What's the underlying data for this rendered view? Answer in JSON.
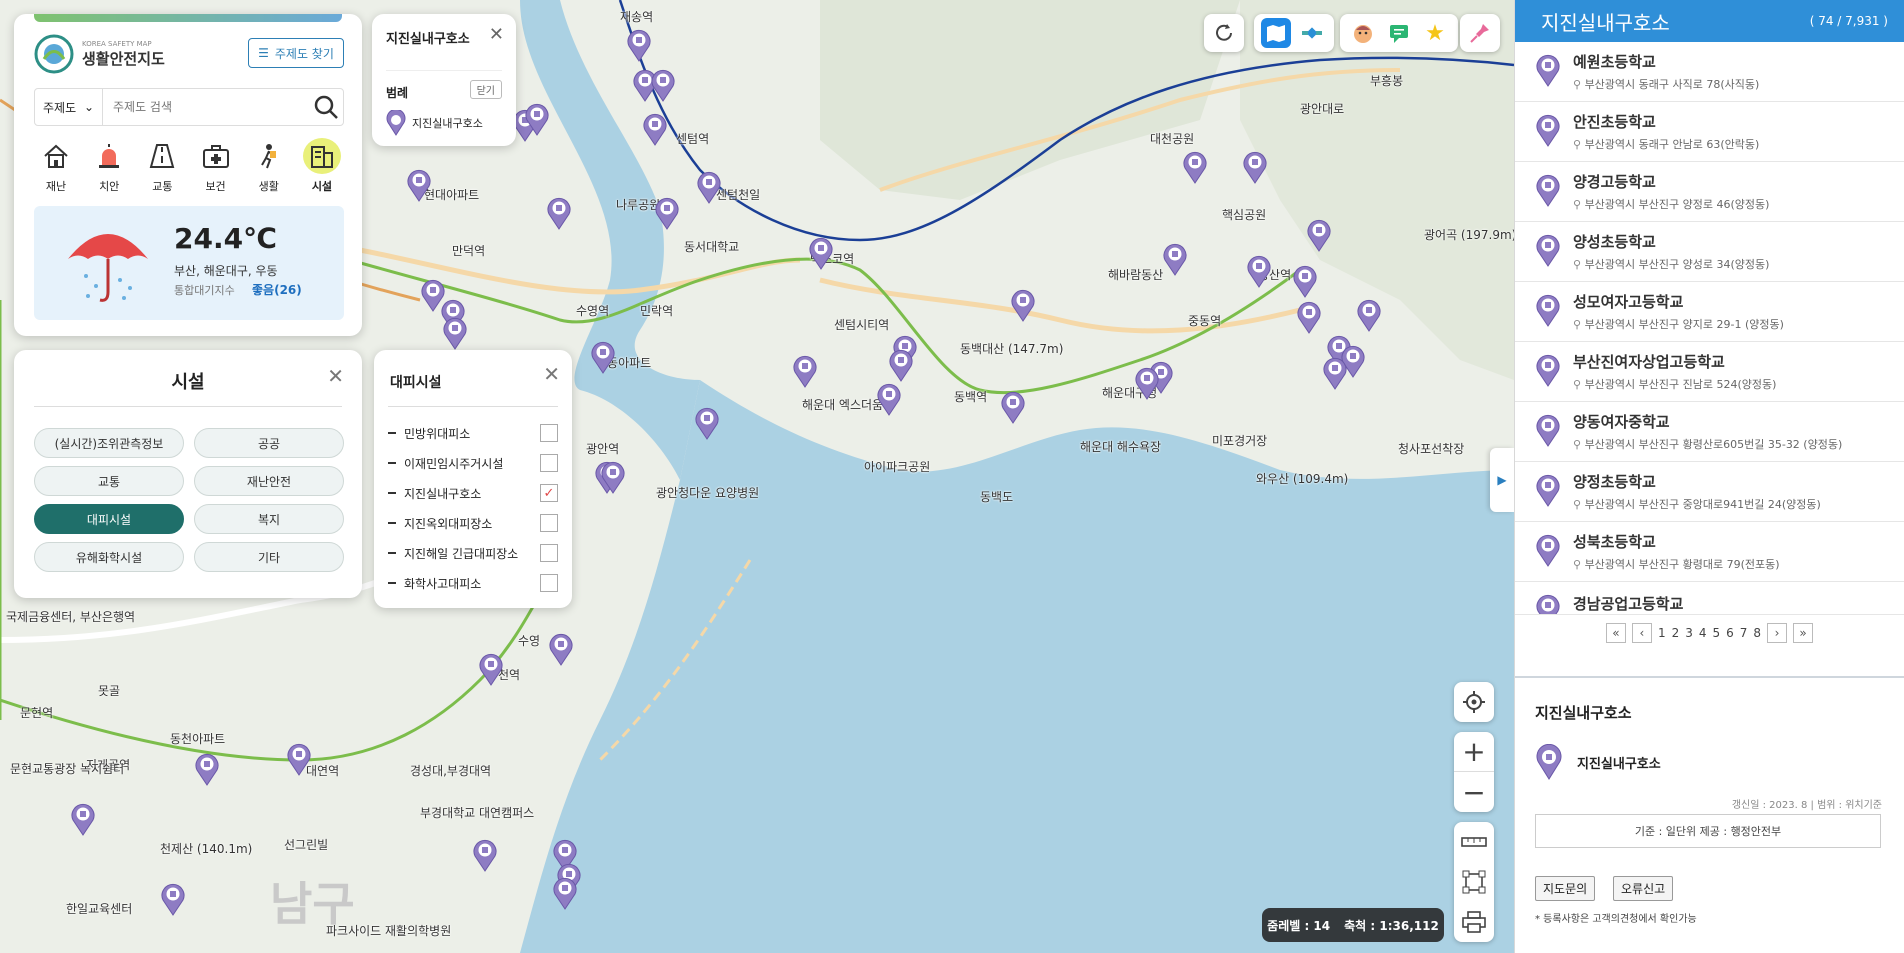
{
  "top_panel": {
    "logo_small": "KOREA SAFETY MAP",
    "logo_title": "생활안전지도",
    "topic_find_label": "주제도 찾기",
    "select_value": "주제도",
    "search_placeholder": "주제도 검색",
    "categories": [
      {
        "label": "재난",
        "icon": "house-icon"
      },
      {
        "label": "치안",
        "icon": "siren-icon"
      },
      {
        "label": "교통",
        "icon": "road-icon"
      },
      {
        "label": "보건",
        "icon": "medical-kit-icon"
      },
      {
        "label": "생활",
        "icon": "hiker-icon"
      },
      {
        "label": "시설",
        "icon": "building-icon"
      }
    ],
    "weather": {
      "temp": "24.4℃",
      "location": "부산, 해운대구, 우동",
      "air_label": "통합대기지수",
      "air_value": "좋음(26)"
    }
  },
  "legend_panel": {
    "title": "지진실내구호소",
    "legend_label": "범례",
    "close_label": "닫기",
    "item": "지진실내구호소"
  },
  "facility_panel": {
    "title": "시설",
    "buttons": [
      "(실시간)조위관측정보",
      "공공",
      "교통",
      "재난안전",
      "대피시설",
      "복지",
      "유해화학시설",
      "기타"
    ],
    "active": "대피시설"
  },
  "shelter_panel": {
    "title": "대피시설",
    "items": [
      {
        "label": "민방위대피소",
        "checked": false
      },
      {
        "label": "이재민임시주거시설",
        "checked": false
      },
      {
        "label": "지진실내구호소",
        "checked": true
      },
      {
        "label": "지진옥외대피장소",
        "checked": false
      },
      {
        "label": "지진해일 긴급대피장소",
        "checked": false
      },
      {
        "label": "화학사고대피소",
        "checked": false
      }
    ]
  },
  "list_panel": {
    "title": "지진실내구호소",
    "count": "( 74 / 7,931 )",
    "items": [
      {
        "name": "예원초등학교",
        "addr": "부산광역시 동래구 사직로 78(사직동)"
      },
      {
        "name": "안진초등학교",
        "addr": "부산광역시 동래구 안남로 63(안락동)"
      },
      {
        "name": "양경고등학교",
        "addr": "부산광역시 부산진구 양정로 46(양정동)"
      },
      {
        "name": "양성초등학교",
        "addr": "부산광역시 부산진구 양성로 34(양정동)"
      },
      {
        "name": "성모여자고등학교",
        "addr": "부산광역시 부산진구 양지로 29-1 (양정동)"
      },
      {
        "name": "부산진여자상업고등학교",
        "addr": "부산광역시 부산진구 진남로 524(양정동)"
      },
      {
        "name": "양동여자중학교",
        "addr": "부산광역시 부산진구 황령산로605번길 35-32 (양정동)"
      },
      {
        "name": "양정초등학교",
        "addr": "부산광역시 부산진구 중앙대로941번길 24(양정동)"
      },
      {
        "name": "성북초등학교",
        "addr": "부산광역시 부산진구 황령대로 79(전포동)"
      },
      {
        "name": "경남공업고등학교",
        "addr": ""
      }
    ],
    "pages": [
      "1",
      "2",
      "3",
      "4",
      "5",
      "6",
      "7",
      "8"
    ]
  },
  "info_panel": {
    "title": "지진실내구호소",
    "legend_item": "지진실내구호소",
    "meta": "갱신일 : 2023. 8   |   범위 : 위치기준",
    "basis": "기준 : 일단위      제공 : 행정안전부",
    "btn_inquiry": "지도문의",
    "btn_report": "오류신고",
    "note": "* 등록사항은 고객의견청에서 확인가능"
  },
  "scale_bar": {
    "zoom": "줌레벨 : 14",
    "scale": "축척 : 1:36,112"
  },
  "map_labels": [
    {
      "t": "재송역"
    },
    {
      "t": "센텀역"
    },
    {
      "t": "센텀천일"
    },
    {
      "t": "나루공원"
    },
    {
      "t": "동서대학교"
    },
    {
      "t": "벡스코역"
    },
    {
      "t": "센텀시티역"
    },
    {
      "t": "현대아파트"
    },
    {
      "t": "만덕역"
    },
    {
      "t": "수영역"
    },
    {
      "t": "민락역"
    },
    {
      "t": "극동아파트"
    },
    {
      "t": "광안역"
    },
    {
      "t": "광안청다운 요양병원"
    },
    {
      "t": "동백역"
    },
    {
      "t": "동백대산 (147.7m)"
    },
    {
      "t": "해운대 엑스더움"
    },
    {
      "t": "아이파크공원"
    },
    {
      "t": "동백도"
    },
    {
      "t": "해운대 해수욕장"
    },
    {
      "t": "해운대구청"
    },
    {
      "t": "미포경거장"
    },
    {
      "t": "와우산 (109.4m)"
    },
    {
      "t": "청사포선착장"
    },
    {
      "t": "중동역"
    },
    {
      "t": "장산역"
    },
    {
      "t": "대천공원"
    },
    {
      "t": "해바람동산"
    },
    {
      "t": "핵심공원"
    },
    {
      "t": "부흥봉"
    },
    {
      "t": "광어곡 (197.9m)"
    },
    {
      "t": "광안대로"
    },
    {
      "t": "국제금융센터, 부산은행역"
    },
    {
      "t": "문현역"
    },
    {
      "t": "지게골역"
    },
    {
      "t": "문현교통광장 녹지쉼터"
    },
    {
      "t": "동천아파트"
    },
    {
      "t": "대연역"
    },
    {
      "t": "경성대,부경대역"
    },
    {
      "t": "부경대학교 대연캠퍼스"
    },
    {
      "t": "천제산 (140.1m)"
    },
    {
      "t": "선그린빌"
    },
    {
      "t": "파크사이드 재활의학병원"
    },
    {
      "t": "한일교육센터"
    },
    {
      "t": "못골"
    },
    {
      "t": "남구"
    },
    {
      "t": "수영"
    },
    {
      "t": "천역"
    }
  ]
}
